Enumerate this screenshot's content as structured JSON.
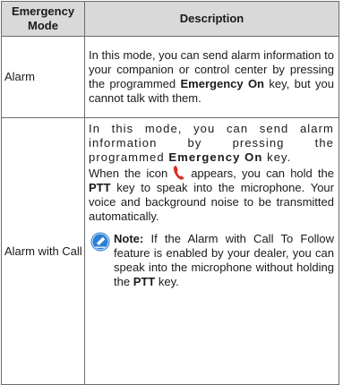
{
  "table": {
    "header": {
      "mode": "Emergency Mode",
      "description": "Description"
    },
    "rows": [
      {
        "mode": "Alarm",
        "desc_1": "In this mode, you can send alarm information to your companion or control center by pressing the programmed ",
        "desc_bold": "Emergency On",
        "desc_2": " key, but you cannot talk with them."
      },
      {
        "mode": "Alarm with Call",
        "p1_1": "In this mode, you can send alarm information by pressing the programmed ",
        "p1_bold": "Emergency On",
        "p1_2": " key.",
        "p2_1": "When the icon",
        "p2_2": "appears, you can hold the ",
        "p2_bold": "PTT",
        "p2_3": " key to speak into the microphone. Your voice and background noise to be transmitted automatically.",
        "note_label": "Note:",
        "note_1": " If the Alarm with Call To Follow feature is enabled by your dealer, you can speak into the microphone without holding the ",
        "note_bold": "PTT",
        "note_2": " key."
      }
    ]
  },
  "icons": {
    "ptt_icon": "red-phone-handset-icon",
    "note_icon": "blue-note-pencil-icon"
  },
  "colors": {
    "header_bg": "#d9d9d9",
    "border": "#6b6b6b",
    "handset_red": "#d9302a",
    "note_blue": "#2a7fd4"
  }
}
